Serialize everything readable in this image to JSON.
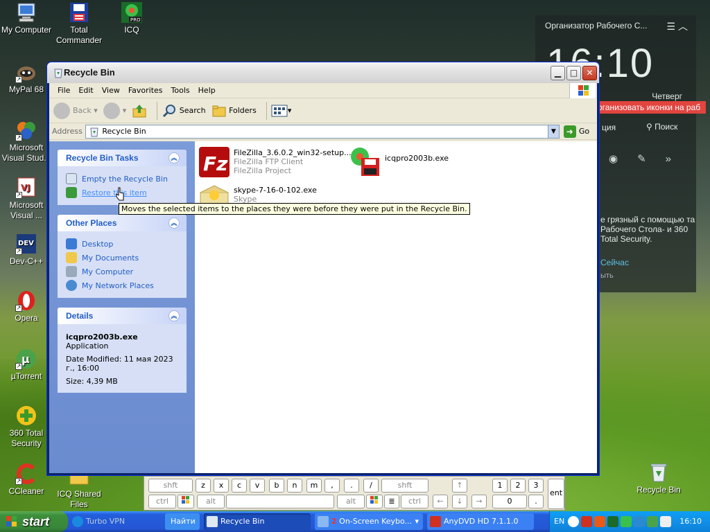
{
  "desktop": {
    "icons": [
      {
        "label": "My Computer"
      },
      {
        "label": "Total Commander"
      },
      {
        "label": "ICQ"
      },
      {
        "label": "MyPal 68"
      },
      {
        "label": "Microsoft Visual Stud..."
      },
      {
        "label": "Microsoft Visual ..."
      },
      {
        "label": "Dev-C++"
      },
      {
        "label": "Opera"
      },
      {
        "label": "µTorrent"
      },
      {
        "label": "360 Total Security"
      },
      {
        "label": "CCleaner"
      },
      {
        "label": "ICQ Shared Files"
      },
      {
        "label": "Recycle Bin"
      }
    ],
    "icq_badge": "PRO",
    "dev_badge": "DEV"
  },
  "gadget": {
    "title": "Организатор Рабочего С...",
    "clock": "16:10",
    "day": "Четверг",
    "banner": "рганизовать иконки на раб",
    "row_label": "ция",
    "search_label": "Поиск",
    "message": "е грязный с помощью та Рабочего Стола- и 360 Total Security.",
    "link": "Сейчас",
    "close": "ыть"
  },
  "window": {
    "title": "Recycle Bin",
    "menu": [
      "File",
      "Edit",
      "View",
      "Favorites",
      "Tools",
      "Help"
    ],
    "toolbar": {
      "back": "Back",
      "search": "Search",
      "folders": "Folders"
    },
    "address": {
      "label": "Address",
      "value": "Recycle Bin",
      "go": "Go"
    },
    "tasks": {
      "title": "Recycle Bin Tasks",
      "items": [
        {
          "label": "Empty the Recycle Bin"
        },
        {
          "label": "Restore this item"
        }
      ]
    },
    "other_places": {
      "title": "Other Places",
      "items": [
        {
          "label": "Desktop"
        },
        {
          "label": "My Documents"
        },
        {
          "label": "My Computer"
        },
        {
          "label": "My Network Places"
        }
      ]
    },
    "details": {
      "title": "Details",
      "name": "icqpro2003b.exe",
      "type": "Application",
      "modified": "Date Modified: 11 мая 2023 г., 16:00",
      "size": "Size: 4,39 MB"
    },
    "files": [
      {
        "name": "FileZilla_3.6.0.2_win32-setup....",
        "line2": "FileZilla FTP Client",
        "line3": "FileZilla Project"
      },
      {
        "name": "icqpro2003b.exe"
      },
      {
        "name": "skype-7-16-0-102.exe",
        "line2": "Skype"
      }
    ],
    "tooltip": "Moves the selected items to the places they were before they were put in the Recycle Bin."
  },
  "keyboard": {
    "row1": [
      "shft",
      "z",
      "x",
      "c",
      "v",
      "b",
      "n",
      "m",
      ",",
      ".",
      "/",
      "shft",
      "↑",
      "1",
      "2",
      "3"
    ],
    "row2": [
      "ctrl",
      "alt",
      "alt",
      "ctrl",
      "←",
      "↓",
      "→",
      "0",
      "."
    ],
    "ent": "ent"
  },
  "taskbar": {
    "start": "start",
    "items": [
      {
        "label": "Turbo VPN"
      },
      {
        "label": "Найти"
      },
      {
        "label": "Recycle Bin"
      },
      {
        "label": "On-Screen Keybo..."
      },
      {
        "label": "AnyDVD HD 7.1.1.0"
      }
    ],
    "osk_count": "2",
    "lang": "EN",
    "time": "16:10"
  },
  "colors": {
    "xp_blue": "#245edb",
    "start_green": "#3c8f3b",
    "link_blue": "#215dc6",
    "tooltip_bg": "#ffffe1"
  }
}
